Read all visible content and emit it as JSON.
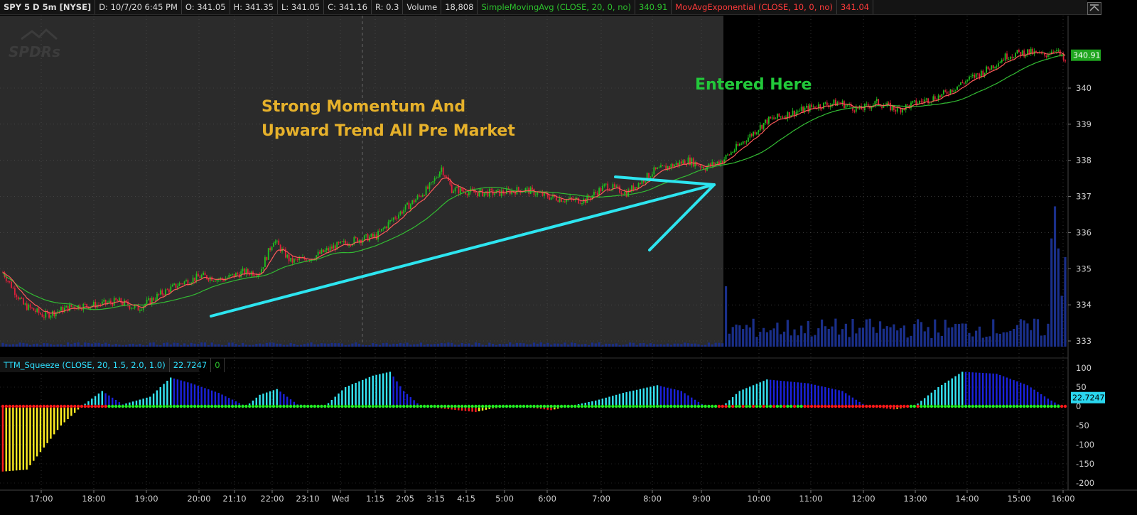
{
  "header": {
    "symbol": "SPY 5 D 5m [NYSE]",
    "date": "D: 10/7/20 6:45 PM",
    "open": "O: 341.05",
    "high": "H: 341.35",
    "low": "L: 341.05",
    "close": "C: 341.16",
    "range": "R: 0.3",
    "volume_label": "Volume",
    "volume_value": "18,808",
    "sma_label": "SimpleMovingAvg (CLOSE, 20, 0, no)",
    "sma_value": "340.91",
    "ema_label": "MovAvgExponential (CLOSE, 10, 0, no)",
    "ema_value": "341.04"
  },
  "lower_header": {
    "study_label": "TTM_Squeeze (CLOSE, 20, 1.5, 2.0, 1.0)",
    "study_value": "22.7247",
    "alert_value": "0"
  },
  "watermark": "SPDRs",
  "price_axis": {
    "ticks": [
      "340",
      "339",
      "338",
      "337",
      "336",
      "335",
      "334",
      "333"
    ],
    "last_marker": "340.91",
    "range": [
      332.9,
      341.0
    ]
  },
  "osc_axis": {
    "ticks": [
      "100",
      "50",
      "0",
      "-50",
      "-100",
      "-150",
      "-200"
    ],
    "last_marker": "22.7247"
  },
  "time_axis": [
    "17:00",
    "18:00",
    "19:00",
    "20:00",
    "21:10",
    "22:00",
    "23:10",
    "Wed",
    "1:15",
    "2:05",
    "3:15",
    "4:15",
    "5:00",
    "6:00",
    "7:00",
    "8:00",
    "9:00",
    "10:00",
    "11:00",
    "12:00",
    "13:00",
    "14:00",
    "15:00",
    "16:00"
  ],
  "annotations": {
    "momentum_line1": "Strong Momentum And",
    "momentum_line2": "Upward Trend All Pre Market",
    "entry": "Entered Here"
  },
  "colors": {
    "premarket_bg": "#2b2b2b",
    "session_bg": "#000000",
    "up_candle": "#1fbf1f",
    "down_candle": "#e0203a",
    "ema_line": "#ff5a5a",
    "sma_line": "#33bb33",
    "volume_bar": "#1a2f8a",
    "hist_cyan": "#35e5f5",
    "hist_blue": "#1b22dd",
    "hist_red": "#ff2020",
    "hist_yellow": "#ffee22",
    "squeeze_on": "#ff1818",
    "squeeze_off": "#22ee22",
    "annotation_gold": "#e6b12b",
    "annotation_green": "#22c93a",
    "arrow": "#2de5f0"
  },
  "chart_data": [
    {
      "type": "candlestick",
      "title": "SPY 5 D 5m [NYSE]",
      "x_labels": [
        "17:00",
        "18:00",
        "19:00",
        "20:00",
        "21:10",
        "22:00",
        "23:10",
        "Wed",
        "1:15",
        "2:05",
        "3:15",
        "4:15",
        "5:00",
        "6:00",
        "7:00",
        "8:00",
        "9:00",
        "10:00",
        "11:00",
        "12:00",
        "13:00",
        "14:00",
        "15:00",
        "16:00"
      ],
      "ylim": [
        332.9,
        341.0
      ],
      "close_path": [
        [
          0,
          334.9
        ],
        [
          12,
          334.0
        ],
        [
          24,
          333.7
        ],
        [
          40,
          333.95
        ],
        [
          55,
          334.0
        ],
        [
          67,
          334.1
        ],
        [
          79,
          333.9
        ],
        [
          92,
          334.3
        ],
        [
          104,
          334.6
        ],
        [
          116,
          334.8
        ],
        [
          128,
          334.7
        ],
        [
          140,
          334.9
        ],
        [
          150,
          334.9
        ],
        [
          158,
          335.8
        ],
        [
          168,
          335.2
        ],
        [
          180,
          335.3
        ],
        [
          193,
          335.6
        ],
        [
          206,
          335.8
        ],
        [
          218,
          335.9
        ],
        [
          228,
          336.4
        ],
        [
          238,
          336.8
        ],
        [
          250,
          337.3
        ],
        [
          256,
          337.8
        ],
        [
          262,
          337.2
        ],
        [
          276,
          337.1
        ],
        [
          290,
          337.1
        ],
        [
          304,
          337.2
        ],
        [
          318,
          337.0
        ],
        [
          331,
          336.9
        ],
        [
          340,
          336.9
        ],
        [
          352,
          337.3
        ],
        [
          364,
          337.1
        ],
        [
          380,
          337.7
        ],
        [
          400,
          338.0
        ],
        [
          410,
          337.8
        ],
        [
          420,
          338.0
        ],
        [
          434,
          338.6
        ],
        [
          446,
          339.1
        ],
        [
          460,
          339.3
        ],
        [
          474,
          339.5
        ],
        [
          488,
          339.6
        ],
        [
          500,
          339.4
        ],
        [
          510,
          339.6
        ],
        [
          522,
          339.4
        ],
        [
          534,
          339.6
        ],
        [
          548,
          339.8
        ],
        [
          562,
          340.2
        ],
        [
          574,
          340.5
        ],
        [
          586,
          340.9
        ],
        [
          598,
          341.0
        ],
        [
          608,
          340.9
        ],
        [
          614,
          341.1
        ],
        [
          620,
          340.7
        ]
      ],
      "series": [
        {
          "name": "SimpleMovingAvg (CLOSE, 20, 0, no)",
          "last": 340.91
        },
        {
          "name": "MovAvgExponential (CLOSE, 10, 0, no)",
          "last": 341.04
        }
      ],
      "volume_last": 18808
    },
    {
      "type": "bar",
      "title": "TTM_Squeeze (CLOSE, 20, 1.5, 2.0, 1.0)",
      "ylim": [
        -200,
        100
      ],
      "last": 22.7247,
      "hist_path": [
        [
          0,
          -170
        ],
        [
          14,
          -165
        ],
        [
          34,
          -50
        ],
        [
          46,
          0
        ],
        [
          58,
          40
        ],
        [
          70,
          5
        ],
        [
          86,
          25
        ],
        [
          98,
          75
        ],
        [
          110,
          60
        ],
        [
          126,
          35
        ],
        [
          142,
          0
        ],
        [
          150,
          30
        ],
        [
          160,
          45
        ],
        [
          172,
          5
        ],
        [
          188,
          0
        ],
        [
          200,
          50
        ],
        [
          216,
          80
        ],
        [
          226,
          90
        ],
        [
          234,
          40
        ],
        [
          244,
          0
        ],
        [
          276,
          -15
        ],
        [
          286,
          -5
        ],
        [
          302,
          0
        ],
        [
          320,
          -10
        ],
        [
          330,
          0
        ],
        [
          346,
          15
        ],
        [
          362,
          35
        ],
        [
          382,
          55
        ],
        [
          396,
          40
        ],
        [
          410,
          0
        ],
        [
          420,
          0
        ],
        [
          430,
          40
        ],
        [
          446,
          70
        ],
        [
          470,
          60
        ],
        [
          490,
          40
        ],
        [
          504,
          0
        ],
        [
          520,
          -8
        ],
        [
          532,
          0
        ],
        [
          546,
          50
        ],
        [
          560,
          90
        ],
        [
          580,
          85
        ],
        [
          598,
          55
        ],
        [
          610,
          20
        ],
        [
          618,
          0
        ]
      ]
    }
  ]
}
